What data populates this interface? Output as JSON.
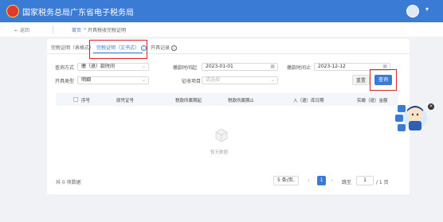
{
  "header": {
    "title": "国家税务总局广东省电子税务局"
  },
  "nav": {
    "back_label": "← 返回",
    "breadcrumb": {
      "home": "首页",
      "sep": ">",
      "current": "开具税收完税证明"
    }
  },
  "tabs": [
    {
      "label": "完税证明（表格式）"
    },
    {
      "label": "完税证明（文书式）",
      "active": true
    },
    {
      "label": "开具记录"
    }
  ],
  "form": {
    "query_method": {
      "label": "查询方式",
      "value": "缴（退）款时间"
    },
    "tax_start": {
      "label": "缴款时间起",
      "value": "2023-01-01"
    },
    "tax_end": {
      "label": "缴款时间止",
      "value": "2023-12-12"
    },
    "issue_type": {
      "label": "开具类型",
      "value": "明细"
    },
    "levy_item": {
      "label": "征收项目",
      "placeholder": "请选择"
    },
    "reset_label": "重置",
    "query_label": "查询"
  },
  "table": {
    "columns": [
      "序号",
      "原凭证号",
      "税款所属期起",
      "税款所属期止",
      "入（退）库日期",
      "实缴（退）金额"
    ],
    "rows": [],
    "empty_text": "暂无数据"
  },
  "pagination": {
    "total": "共 0 项数据",
    "page_size": "5 条/页",
    "current_page": "1",
    "goto_label": "跳至",
    "goto_value": "1",
    "total_pages": "/ 1 页"
  },
  "mascot": {
    "caption": "纳税互动",
    "close": "×"
  },
  "colors": {
    "header": "#3a7bd5",
    "accent": "#3a7bd5",
    "highlight_box": "#e02020"
  }
}
